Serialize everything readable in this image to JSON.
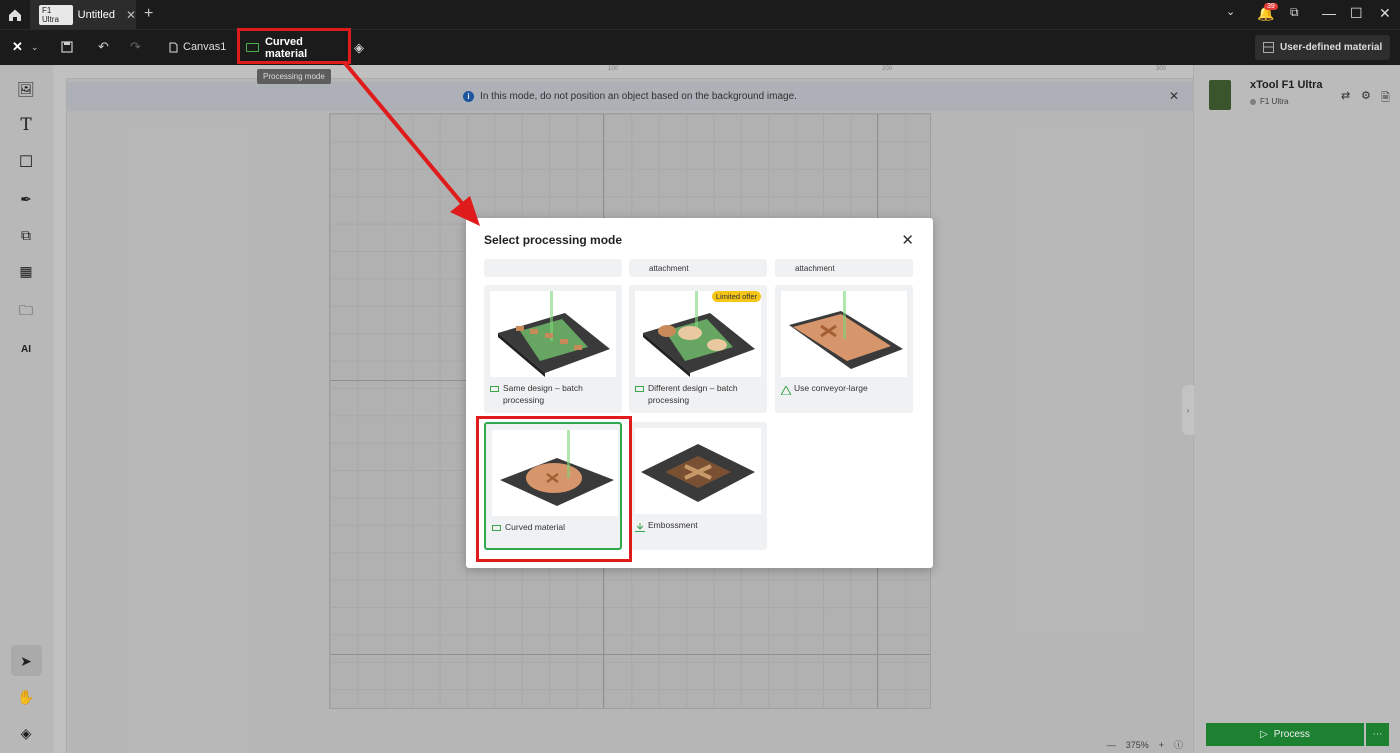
{
  "titlebar": {
    "tab_badge": "F1 Ultra",
    "tab_title": "Untitled",
    "notification_count": "39"
  },
  "toolbar": {
    "canvas_label": "Canvas1",
    "mode_label": "Curved material",
    "tooltip": "Processing mode",
    "user_material": "User-defined material"
  },
  "canvas": {
    "info_text": "In this mode, do not position an object based on the background image.",
    "ruler_marks": [
      "100",
      "200",
      "300"
    ],
    "zoom": "375%"
  },
  "device": {
    "name": "xTool F1 Ultra",
    "model": "F1 Ultra"
  },
  "process_label": "Process",
  "modal": {
    "title": "Select processing mode",
    "partial_labels": [
      "",
      "attachment",
      "attachment"
    ],
    "cards": [
      {
        "label": "Same design – batch processing",
        "icon": "batch-icon"
      },
      {
        "label": "Different design – batch processing",
        "icon": "batch-icon",
        "badge": "Limited offer"
      },
      {
        "label": "Use conveyor-large",
        "icon": "conveyor-icon"
      },
      {
        "label": "Curved material",
        "icon": "curved-icon",
        "selected": true
      },
      {
        "label": "Embossment",
        "icon": "embossment-icon"
      }
    ]
  },
  "colors": {
    "accent_green": "#1f8a36",
    "highlight_red": "#e01b1b",
    "badge_yellow": "#f5c518",
    "info_blue": "#1e5aa8"
  }
}
